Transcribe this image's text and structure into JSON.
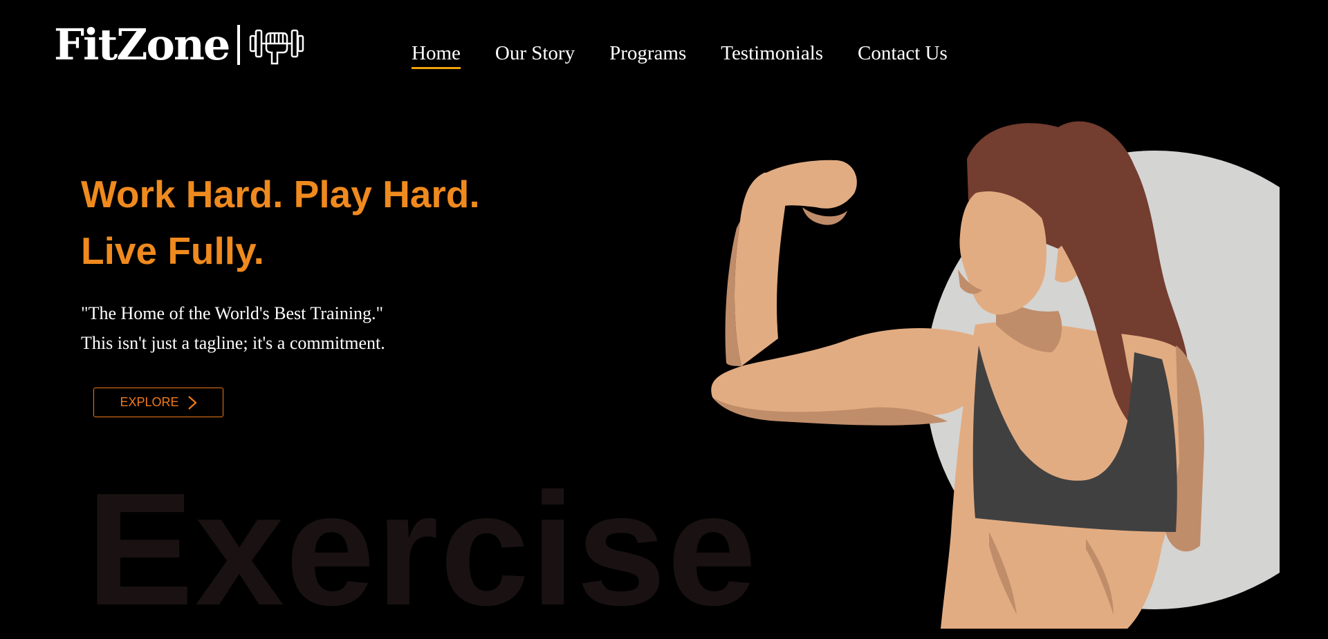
{
  "brand": {
    "name": "FitZone",
    "icon": "dumbbell-fist-icon"
  },
  "nav": {
    "items": [
      {
        "label": "Home",
        "active": true
      },
      {
        "label": "Our Story",
        "active": false
      },
      {
        "label": "Programs",
        "active": false
      },
      {
        "label": "Testimonials",
        "active": false
      },
      {
        "label": "Contact Us",
        "active": false
      }
    ]
  },
  "hero": {
    "title_line1": "Work Hard. Play Hard.",
    "title_line2": "Live Fully.",
    "quote": "\"The Home of the World's Best Training.\"",
    "subtext": "This isn't just a tagline; it's a commitment.",
    "button_label": "EXPLORE",
    "button_icon": "chevron-right-icon",
    "background_word": "Exercise",
    "illustration": "woman-flexing-bicep-illustration"
  },
  "colors": {
    "background": "#000000",
    "accent_orange": "#ef8a1e",
    "nav_underline": "#f0a30a",
    "circle": "#d4d4d2"
  }
}
